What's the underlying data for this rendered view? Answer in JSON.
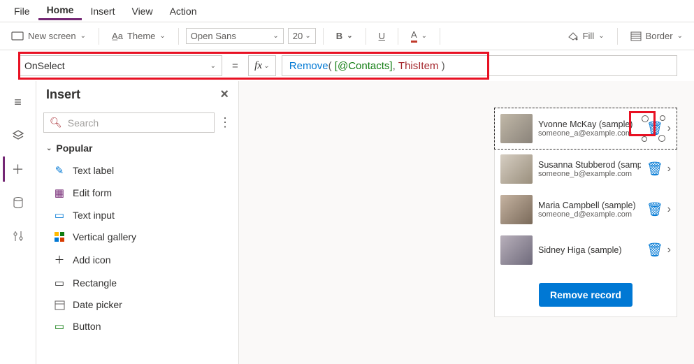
{
  "menu": {
    "file": "File",
    "home": "Home",
    "insert": "Insert",
    "view": "View",
    "action": "Action"
  },
  "ribbon": {
    "new_screen": "New screen",
    "theme": "Theme",
    "font_name": "Open Sans",
    "font_size": "20",
    "fill": "Fill",
    "border": "Border"
  },
  "formula": {
    "property": "OnSelect",
    "fn": "Remove",
    "arg1": "[@Contacts]",
    "arg2": "ThisItem"
  },
  "insert": {
    "title": "Insert",
    "search_placeholder": "Search",
    "category": "Popular",
    "items": [
      {
        "icon": "label",
        "label": "Text label"
      },
      {
        "icon": "form",
        "label": "Edit form"
      },
      {
        "icon": "input",
        "label": "Text input"
      },
      {
        "icon": "gallery",
        "label": "Vertical gallery"
      },
      {
        "icon": "plus",
        "label": "Add icon"
      },
      {
        "icon": "rect",
        "label": "Rectangle"
      },
      {
        "icon": "date",
        "label": "Date picker"
      },
      {
        "icon": "button",
        "label": "Button"
      }
    ]
  },
  "contacts": [
    {
      "name": "Yvonne McKay (sample)",
      "email": "someone_a@example.com"
    },
    {
      "name": "Susanna Stubberod (sample)",
      "email": "someone_b@example.com"
    },
    {
      "name": "Maria Campbell (sample)",
      "email": "someone_d@example.com"
    },
    {
      "name": "Sidney Higa (sample)",
      "email": ""
    }
  ],
  "remove_button": "Remove record"
}
